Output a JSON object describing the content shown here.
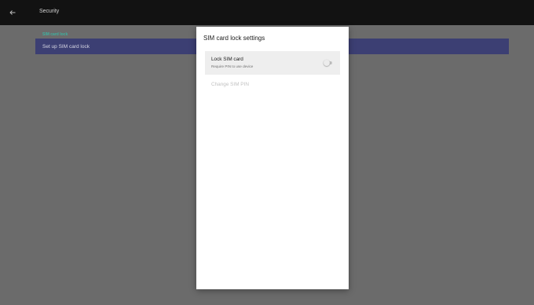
{
  "app_bar": {
    "title": "Security",
    "back_icon": "arrow-left-icon"
  },
  "settings_list": {
    "section_header": "SIM card lock",
    "section_color": "#3fb09f",
    "item_label": "Set up SIM card lock",
    "item_highlight_color": "#3c3f73"
  },
  "dialog": {
    "title": "SIM card lock settings",
    "lock_sim": {
      "title": "Lock SIM card",
      "summary": "Require PIN to use device",
      "switch_on": false
    },
    "change_pin": {
      "label": "Change SIM PIN",
      "enabled": false
    }
  }
}
